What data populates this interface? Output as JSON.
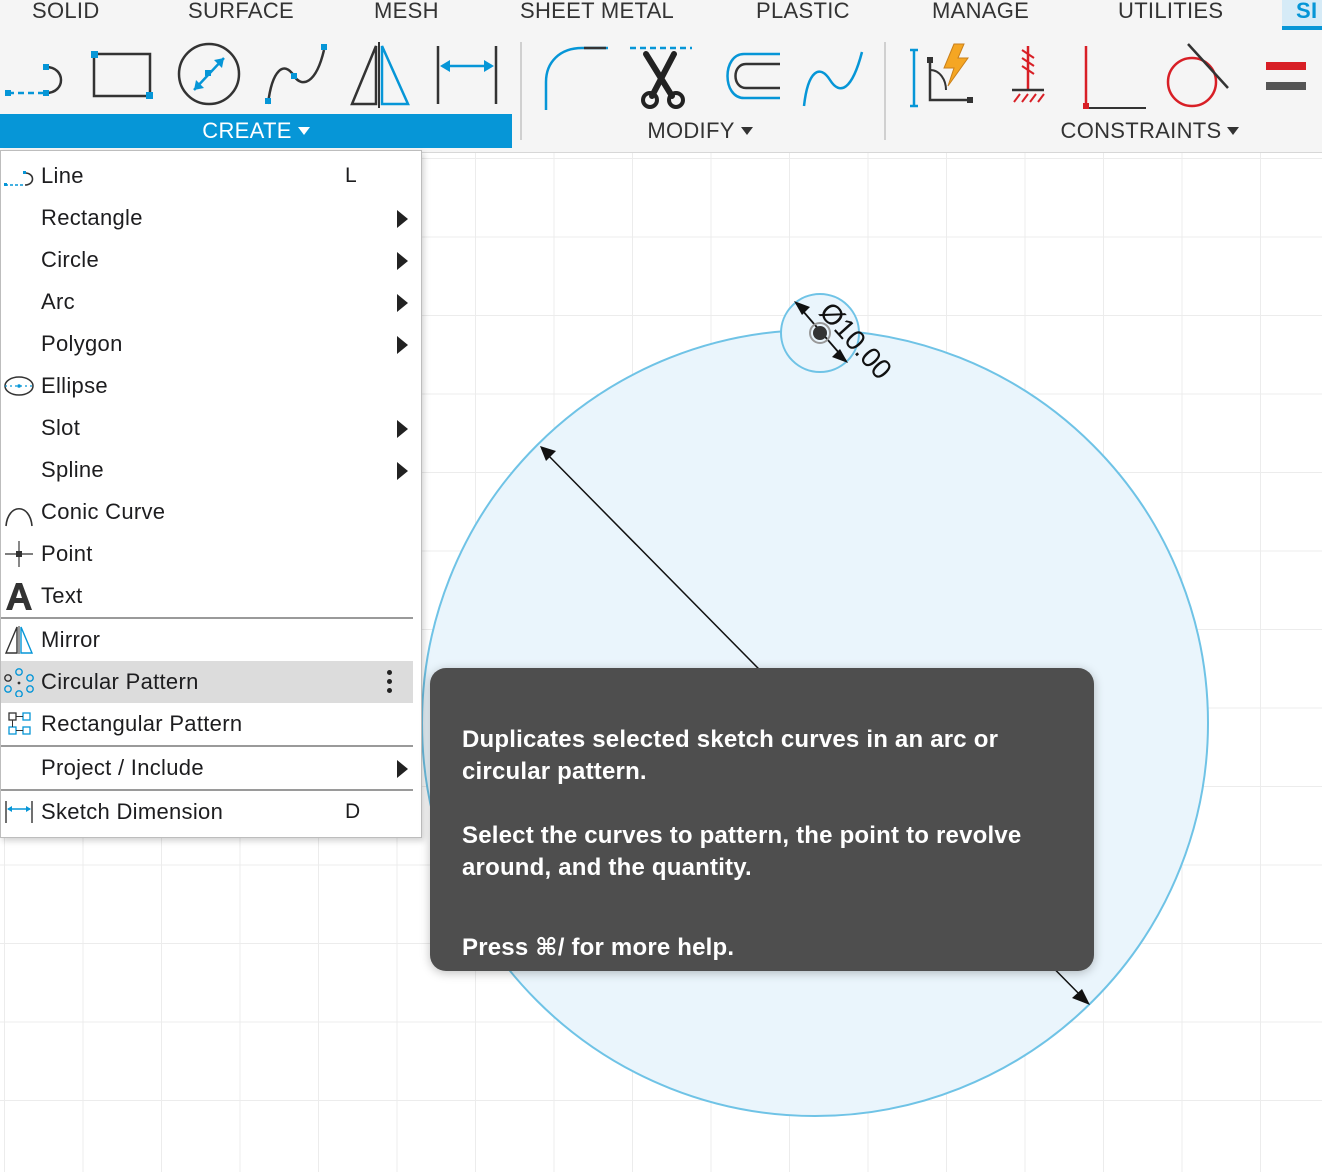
{
  "tabs": [
    {
      "label": "SOLID",
      "active": false
    },
    {
      "label": "SURFACE",
      "active": false
    },
    {
      "label": "MESH",
      "active": false
    },
    {
      "label": "SHEET METAL",
      "active": false
    },
    {
      "label": "PLASTIC",
      "active": false
    },
    {
      "label": "MANAGE",
      "active": false
    },
    {
      "label": "UTILITIES",
      "active": false
    },
    {
      "label": "SI",
      "active": true
    }
  ],
  "toolbar": {
    "groups": [
      {
        "label": "CREATE",
        "active": true
      },
      {
        "label": "MODIFY",
        "active": false
      },
      {
        "label": "CONSTRAINTS",
        "active": false
      }
    ],
    "create_tools": [
      "line-tool-icon",
      "rectangle-tool-icon",
      "circle-tool-icon",
      "spline-tool-icon",
      "mirror-tool-icon",
      "dimension-tool-icon"
    ],
    "modify_tools": [
      "fillet-tool-icon",
      "trim-tool-icon",
      "offset-tool-icon",
      "spline-modify-icon"
    ],
    "constraint_tools": [
      "auto-constrain-icon",
      "fix-constraint-icon",
      "perpendicular-constraint-icon",
      "tangent-constraint-icon",
      "equal-constraint-icon"
    ]
  },
  "menu": {
    "items": [
      {
        "label": "Line",
        "shortcut": "L",
        "submenu": false,
        "icon": "line-icon"
      },
      {
        "label": "Rectangle",
        "shortcut": "",
        "submenu": true,
        "icon": ""
      },
      {
        "label": "Circle",
        "shortcut": "",
        "submenu": true,
        "icon": ""
      },
      {
        "label": "Arc",
        "shortcut": "",
        "submenu": true,
        "icon": ""
      },
      {
        "label": "Polygon",
        "shortcut": "",
        "submenu": true,
        "icon": ""
      },
      {
        "label": "Ellipse",
        "shortcut": "",
        "submenu": false,
        "icon": "ellipse-icon"
      },
      {
        "label": "Slot",
        "shortcut": "",
        "submenu": true,
        "icon": ""
      },
      {
        "label": "Spline",
        "shortcut": "",
        "submenu": true,
        "icon": ""
      },
      {
        "label": "Conic Curve",
        "shortcut": "",
        "submenu": false,
        "icon": "conic-curve-icon"
      },
      {
        "label": "Point",
        "shortcut": "",
        "submenu": false,
        "icon": "point-icon"
      },
      {
        "label": "Text",
        "shortcut": "",
        "submenu": false,
        "icon": "text-icon"
      },
      {
        "label": "Mirror",
        "shortcut": "",
        "submenu": false,
        "icon": "mirror-icon"
      },
      {
        "label": "Circular Pattern",
        "shortcut": "",
        "submenu": false,
        "icon": "circular-pattern-icon",
        "highlighted": true
      },
      {
        "label": "Rectangular Pattern",
        "shortcut": "",
        "submenu": false,
        "icon": "rectangular-pattern-icon"
      },
      {
        "label": "Project / Include",
        "shortcut": "",
        "submenu": true,
        "icon": ""
      },
      {
        "label": "Sketch Dimension",
        "shortcut": "D",
        "submenu": false,
        "icon": "sketch-dimension-icon"
      }
    ]
  },
  "sketch": {
    "dimension_text": "Ø10.00",
    "accent_color": "#6fc3e6",
    "fill_color": "#eaf5fc"
  },
  "tooltip": {
    "line1": "Duplicates selected sketch curves in an arc or circular pattern.",
    "line2": "Select the curves to pattern, the point to revolve around, and the quantity.",
    "line3": "Press ⌘/ for more help."
  },
  "colors": {
    "brand_blue": "#0696d7",
    "toolbar_bg": "#f5f5f5",
    "tooltip_bg": "#4e4e4e",
    "menu_highlight": "#dcdcdc",
    "constraint_red": "#d81f26"
  }
}
